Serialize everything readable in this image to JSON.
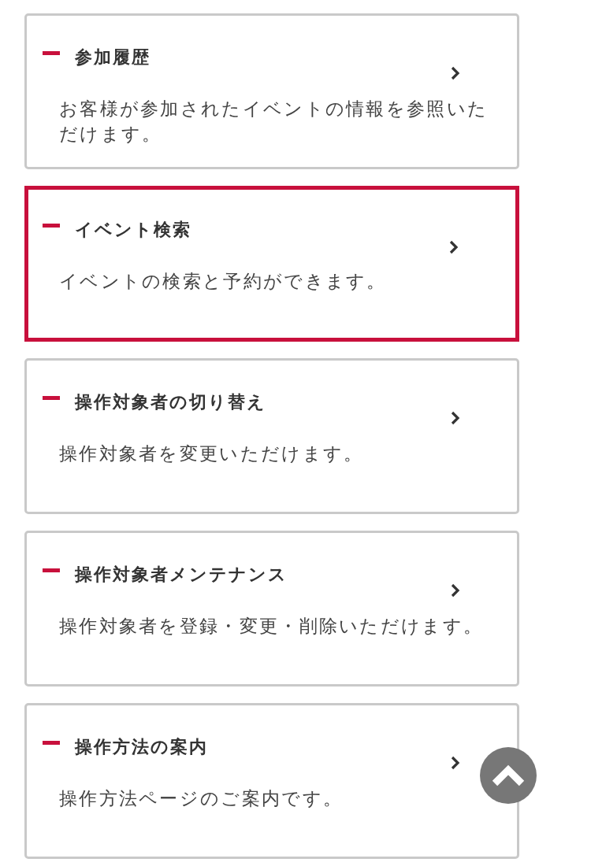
{
  "menu_items": [
    {
      "title": "参加履歴",
      "description": "お客様が参加されたイベントの情報を参照いただけます。",
      "selected": false
    },
    {
      "title": "イベント検索",
      "description": "イベントの検索と予約ができます。",
      "selected": true
    },
    {
      "title": "操作対象者の切り替え",
      "description": "操作対象者を変更いただけます。",
      "selected": false
    },
    {
      "title": "操作対象者メンテナンス",
      "description": "操作対象者を登録・変更・削除いただけます。",
      "selected": false
    },
    {
      "title": "操作方法の案内",
      "description": "操作方法ページのご案内です。",
      "selected": false
    }
  ]
}
